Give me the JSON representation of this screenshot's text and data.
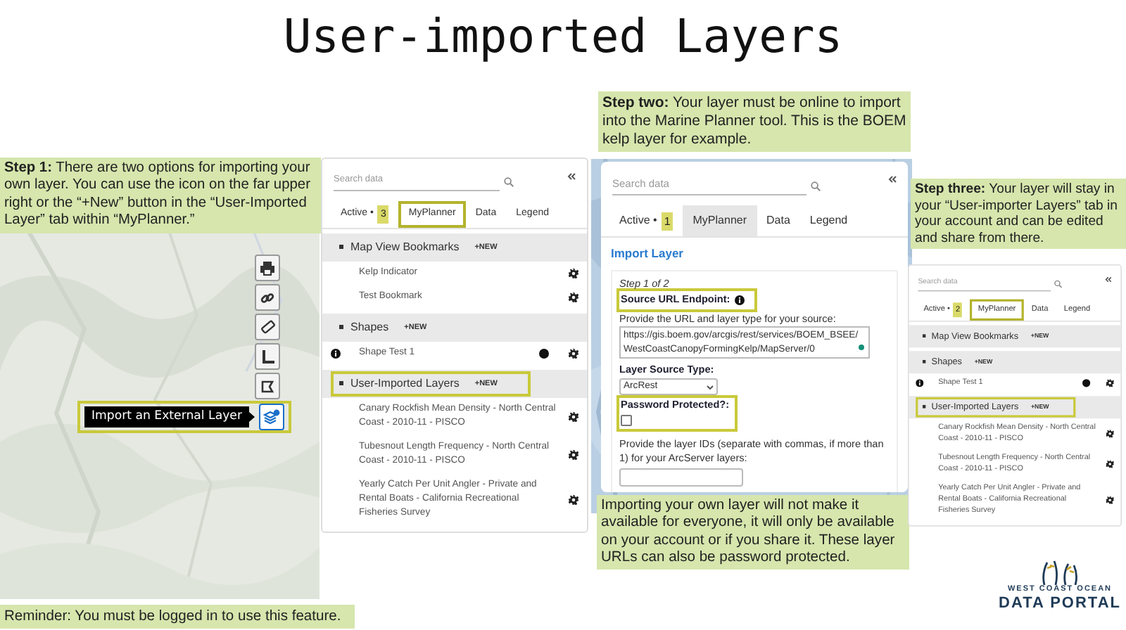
{
  "title": "User-imported Layers",
  "notes": [
    {
      "text": "**Step 1:** There are two options for importing your own layer. You can use the icon on the far upper right or the “+New” button in the “User-Imported Layer” tab within “MyPlanner.”"
    },
    {
      "text": "**Step two:** Your layer must be online to import into the Marine Planner tool. This is the BOEM kelp layer for example."
    },
    {
      "text": "Importing your own layer will not make it available for everyone, it will only be available on your account or if you share it. These layer URLs can also be password protected."
    },
    {
      "text": "**Step three:** Your layer will stay in your “User-importer Layers” tab in your account and can be edited and share from there."
    },
    {
      "text": "Reminder: You must be logged in to use this feature."
    }
  ],
  "map_toolbar": {
    "tools": [
      {
        "kind": "print",
        "active": false
      },
      {
        "kind": "link",
        "active": false
      },
      {
        "kind": "ruler",
        "active": false
      },
      {
        "kind": "angle",
        "active": false
      },
      {
        "kind": "polygon",
        "active": false
      },
      {
        "kind": "import",
        "active": true
      }
    ],
    "tooltip": "Import an External Layer",
    "highlighted": true
  },
  "panels": [
    {
      "kind": "layers",
      "search_placeholder": "Search data",
      "tabs": [
        {
          "label": "Active •",
          "badge": "3",
          "selected": false,
          "highlighted": false
        },
        {
          "label": "MyPlanner",
          "selected": false,
          "highlighted": true
        },
        {
          "label": "Data",
          "selected": false,
          "highlighted": false
        },
        {
          "label": "Legend",
          "selected": false,
          "highlighted": false
        }
      ],
      "sections": [
        {
          "label": "Map View Bookmarks",
          "new": "+NEW",
          "highlighted": false,
          "items": [
            {
              "text": "Kelp Indicator"
            },
            {
              "text": "Test Bookmark"
            }
          ]
        },
        {
          "label": "Shapes",
          "new": "+NEW",
          "highlighted": false,
          "items": [
            {
              "text": "Shape Test 1",
              "info": true,
              "dot": true
            }
          ]
        },
        {
          "label": "User-Imported Layers",
          "new": "+NEW",
          "highlighted": true,
          "items": [
            {
              "text": "Canary Rockfish Mean Density - North Central Coast - 2010-11 - PISCO"
            },
            {
              "text": "Tubesnout Length Frequency - North Central Coast - 2010-11 - PISCO"
            },
            {
              "text": "Yearly Catch Per Unit Angler - Private and Rental Boats - California Recreational Fisheries Survey"
            }
          ]
        }
      ]
    },
    {
      "kind": "import",
      "search_placeholder": "Search data",
      "tabs": [
        {
          "label": "Active •",
          "badge": "1",
          "selected": false
        },
        {
          "label": "MyPlanner",
          "selected": true
        },
        {
          "label": "Data",
          "selected": false
        },
        {
          "label": "Legend",
          "selected": false
        }
      ],
      "form": {
        "heading": "Import Layer",
        "step": "Step 1 of 2",
        "source_label": "Source URL Endpoint:",
        "source_highlighted": true,
        "url_prompt": "Provide the URL and layer type for your source:",
        "url_value": "https://gis.boem.gov/arcgis/rest/services/BOEM_BSEE/WestCoastCanopyFormingKelp/MapServer/0",
        "type_label": "Layer Source Type:",
        "type_value": "ArcRest",
        "password_label": "Password Protected?:",
        "password_checked": false,
        "password_highlighted": true,
        "ids_prompt": "Provide the layer IDs (separate with commas, if more than 1) for your ArcServer layers:"
      }
    },
    {
      "kind": "layers",
      "search_placeholder": "Search data",
      "tabs": [
        {
          "label": "Active •",
          "badge": "2",
          "selected": false,
          "highlighted": false
        },
        {
          "label": "MyPlanner",
          "selected": false,
          "highlighted": true
        },
        {
          "label": "Data",
          "selected": false,
          "highlighted": false
        },
        {
          "label": "Legend",
          "selected": false,
          "highlighted": false
        }
      ],
      "sections": [
        {
          "label": "Map View Bookmarks",
          "new": "+NEW",
          "highlighted": false
        },
        {
          "label": "Shapes",
          "new": "+NEW",
          "highlighted": false,
          "items": [
            {
              "text": "Shape Test 1",
              "info": true,
              "dot": true
            }
          ]
        },
        {
          "label": "User-Imported Layers",
          "new": "+NEW",
          "highlighted": true,
          "items": [
            {
              "text": "Canary Rockfish Mean Density - North Central Coast - 2010-11 - PISCO"
            },
            {
              "text": "Tubesnout Length Frequency - North Central Coast - 2010-11 - PISCO"
            },
            {
              "text": "Yearly Catch Per Unit Angler - Private and Rental Boats - California Recreational Fisheries Survey"
            }
          ]
        }
      ]
    }
  ],
  "logo": {
    "line1": "WEST COAST OCEAN",
    "line2": "DATA PORTAL"
  }
}
